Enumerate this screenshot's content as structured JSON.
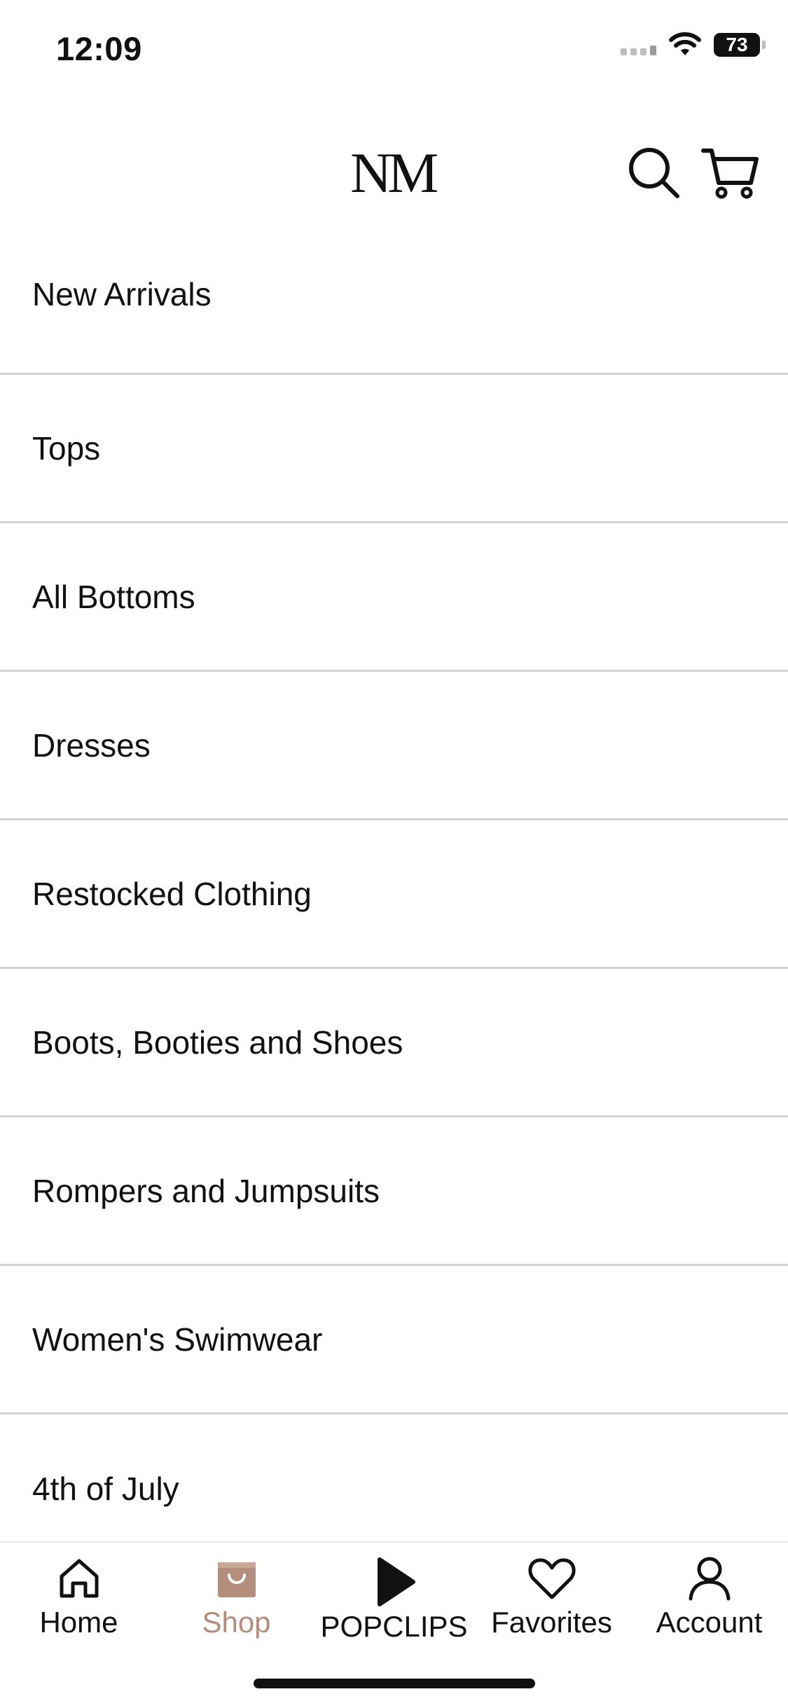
{
  "status": {
    "time": "12:09",
    "battery": "73"
  },
  "header": {
    "logo_text": "NM",
    "logo_dot": "."
  },
  "menu": {
    "items": [
      {
        "label": "New Arrivals"
      },
      {
        "label": "Tops"
      },
      {
        "label": "All Bottoms"
      },
      {
        "label": "Dresses"
      },
      {
        "label": "Restocked Clothing"
      },
      {
        "label": "Boots, Booties and Shoes"
      },
      {
        "label": "Rompers and Jumpsuits"
      },
      {
        "label": "Women's Swimwear"
      },
      {
        "label": "4th of July"
      }
    ]
  },
  "tabs": [
    {
      "label": "Home",
      "icon": "home-icon"
    },
    {
      "label": "Shop",
      "icon": "shopping-bag-icon",
      "active": true
    },
    {
      "label": "POPCLIPS",
      "icon": "play-icon"
    },
    {
      "label": "Favorites",
      "icon": "heart-icon"
    },
    {
      "label": "Account",
      "icon": "person-icon"
    }
  ],
  "colors": {
    "accent": "#b58d7c",
    "divider": "#d2d2d2",
    "text": "#111111"
  }
}
